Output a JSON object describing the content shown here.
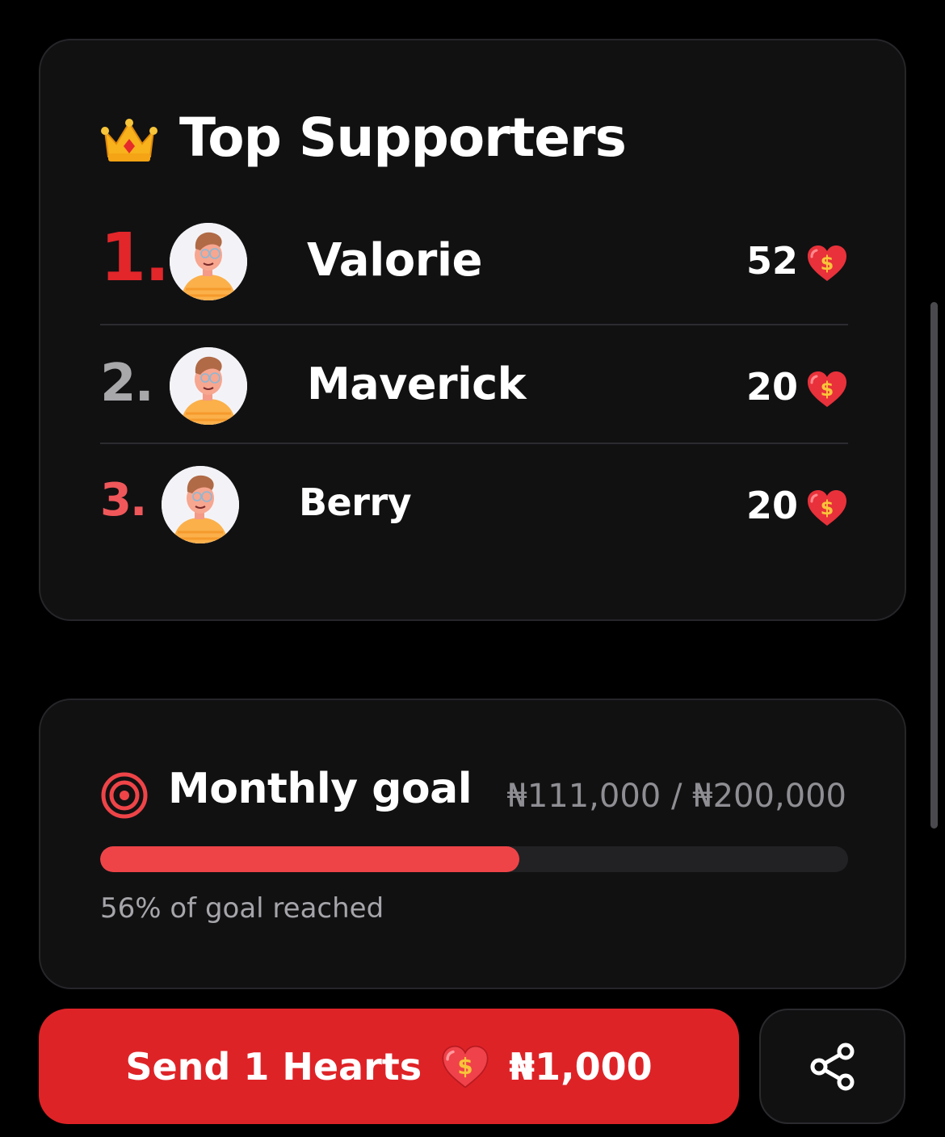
{
  "top_supporters": {
    "title": "Top Supporters",
    "icon": "crown-icon",
    "supporters": [
      {
        "rank": "1.",
        "name": "Valorie",
        "hearts": "52",
        "rank_color": "#e2262a"
      },
      {
        "rank": "2.",
        "name": "Maverick",
        "hearts": "20",
        "rank_color": "#a8a8ab"
      },
      {
        "rank": "3.",
        "name": "Berry",
        "hearts": "20",
        "rank_color": "#f0575a"
      }
    ]
  },
  "monthly_goal": {
    "title": "Monthly goal",
    "icon": "target-icon",
    "amount": "₦111,000 / ₦200,000",
    "progress_fraction": 0.56,
    "caption": "56% of goal reached"
  },
  "actions": {
    "send_label": "Send 1 Hearts",
    "send_price": "₦1,000",
    "share_icon": "share-icon"
  },
  "colors": {
    "accent": "#de2327",
    "progress": "#ee4448",
    "card_bg": "#111112"
  }
}
